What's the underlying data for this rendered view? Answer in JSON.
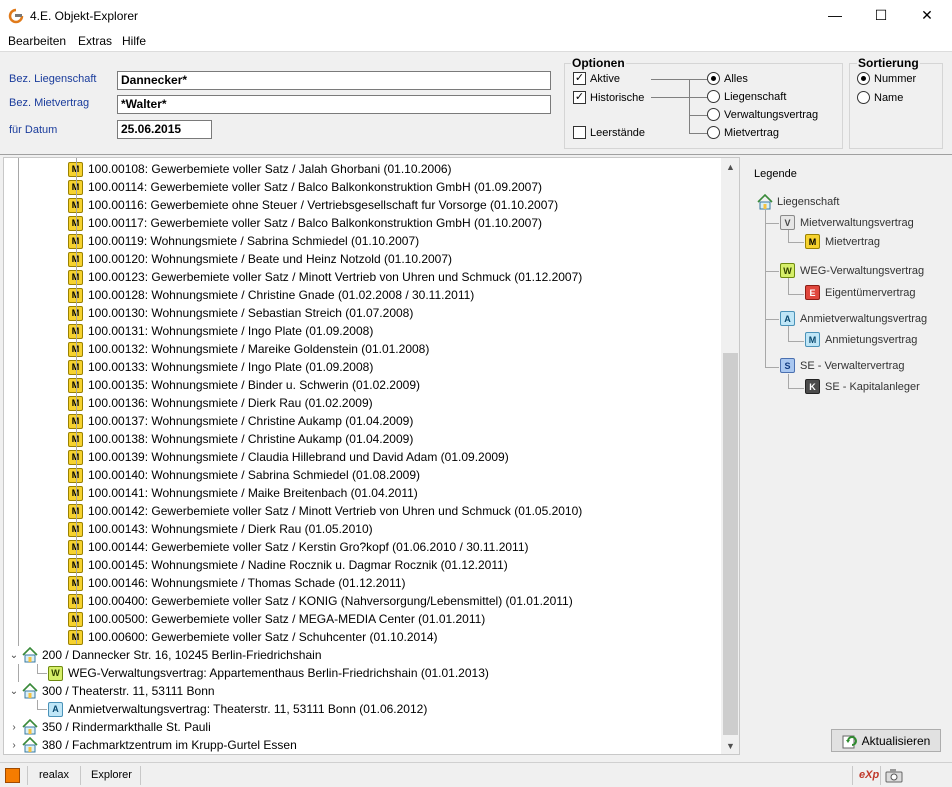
{
  "window": {
    "title": "4.E. Objekt-Explorer",
    "min": "—",
    "max": "☐",
    "close": "✕"
  },
  "menu": [
    "Bearbeiten",
    "Extras",
    "Hilfe"
  ],
  "form": {
    "liegenschaft_label": "Bez. Liegenschaft",
    "liegenschaft_value": "Dannecker*",
    "mietvertrag_label": "Bez. Mietvertrag",
    "mietvertrag_value": "*Walter*",
    "datum_label": "für Datum",
    "datum_value": "25.06.2015"
  },
  "optionen": {
    "title": "Optionen",
    "aktive": {
      "label": "Aktive",
      "checked": true
    },
    "historische": {
      "label": "Historische",
      "checked": true
    },
    "leerstaende": {
      "label": "Leerstände",
      "checked": false
    },
    "radios": [
      {
        "label": "Alles",
        "selected": true
      },
      {
        "label": "Liegenschaft",
        "selected": false
      },
      {
        "label": "Verwaltungsvertrag",
        "selected": false
      },
      {
        "label": "Mietvertrag",
        "selected": false
      }
    ]
  },
  "sortierung": {
    "title": "Sortierung",
    "radios": [
      {
        "label": "Nummer",
        "selected": true
      },
      {
        "label": "Name",
        "selected": false
      }
    ]
  },
  "tree": {
    "contracts": [
      "100.00108: Gewerbemiete voller Satz / Jalah Ghorbani (01.10.2006)",
      "100.00114: Gewerbemiete voller Satz / Balco Balkonkonstruktion GmbH (01.09.2007)",
      "100.00116: Gewerbemiete ohne Steuer / Vertriebsgesellschaft fur Vorsorge (01.10.2007)",
      "100.00117: Gewerbemiete voller Satz / Balco Balkonkonstruktion GmbH (01.10.2007)",
      "100.00119: Wohnungsmiete / Sabrina Schmiedel (01.10.2007)",
      "100.00120: Wohnungsmiete / Beate und Heinz Notzold (01.10.2007)",
      "100.00123: Gewerbemiete voller Satz / Minott Vertrieb von Uhren und Schmuck (01.12.2007)",
      "100.00128: Wohnungsmiete / Christine Gnade (01.02.2008 / 30.11.2011)",
      "100.00130: Wohnungsmiete / Sebastian Streich (01.07.2008)",
      "100.00131: Wohnungsmiete / Ingo Plate (01.09.2008)",
      "100.00132: Wohnungsmiete / Mareike Goldenstein (01.01.2008)",
      "100.00133: Wohnungsmiete / Ingo Plate (01.09.2008)",
      "100.00135: Wohnungsmiete / Binder u. Schwerin (01.02.2009)",
      "100.00136: Wohnungsmiete / Dierk Rau (01.02.2009)",
      "100.00137: Wohnungsmiete / Christine Aukamp (01.04.2009)",
      "100.00138: Wohnungsmiete / Christine Aukamp (01.04.2009)",
      "100.00139: Wohnungsmiete / Claudia Hillebrand und David Adam (01.09.2009)",
      "100.00140: Wohnungsmiete / Sabrina Schmiedel (01.08.2009)",
      "100.00141: Wohnungsmiete / Maike Breitenbach (01.04.2011)",
      "100.00142: Gewerbemiete voller Satz / Minott Vertrieb von Uhren und Schmuck (01.05.2010)",
      "100.00143: Wohnungsmiete / Dierk Rau (01.05.2010)",
      "100.00144: Gewerbemiete voller Satz / Kerstin Gro?kopf (01.06.2010 / 30.11.2011)",
      "100.00145: Wohnungsmiete / Nadine Rocznik u. Dagmar Rocznik (01.12.2011)",
      "100.00146: Wohnungsmiete / Thomas Schade (01.12.2011)",
      "100.00400: Gewerbemiete voller Satz / KONIG (Nahversorgung/Lebensmittel) (01.01.2011)",
      "100.00500: Gewerbemiete voller Satz / MEGA-MEDIA Center (01.01.2011)",
      "100.00600: Gewerbemiete voller Satz / Schuhcenter (01.10.2014)"
    ],
    "prop200": "200 / Dannecker Str. 16, 10245 Berlin-Friedrichshain",
    "weg200": "WEG-Verwaltungsvertrag: Appartementhaus Berlin-Friedrichshain (01.01.2013)",
    "prop300": "300 / Theaterstr. 11, 53111 Bonn",
    "anm300": "Anmietverwaltungsvertrag: Theaterstr. 11, 53111 Bonn (01.06.2012)",
    "prop350": "350 / Rindermarkthalle St. Pauli",
    "prop380": "380 / Fachmarktzentrum im Krupp-Gurtel Essen"
  },
  "legend": {
    "title": "Legende",
    "items": {
      "liegenschaft": "Liegenschaft",
      "mietverwaltung": "Mietverwaltungsvertrag",
      "mietvertrag": "Mietvertrag",
      "weg": "WEG-Verwaltungsvertrag",
      "eigentuemer": "Eigentümervertrag",
      "anmietverwaltung": "Anmietverwaltungsvertrag",
      "anmietung": "Anmietungsvertrag",
      "se_verwalter": "SE - Verwaltervertrag",
      "se_kapital": "SE - Kapitalanleger"
    },
    "badges": {
      "V": "V",
      "M": "M",
      "W": "W",
      "E": "E",
      "A": "A",
      "S": "S",
      "K": "K"
    }
  },
  "refresh_button": "Aktualisieren",
  "status": {
    "left": "realax",
    "mid": "Explorer",
    "exp": "eXp"
  },
  "colors": {
    "accent_orange": "#f57c00",
    "label_blue": "#1a3c9c",
    "badge_M": "#f6d22e"
  }
}
